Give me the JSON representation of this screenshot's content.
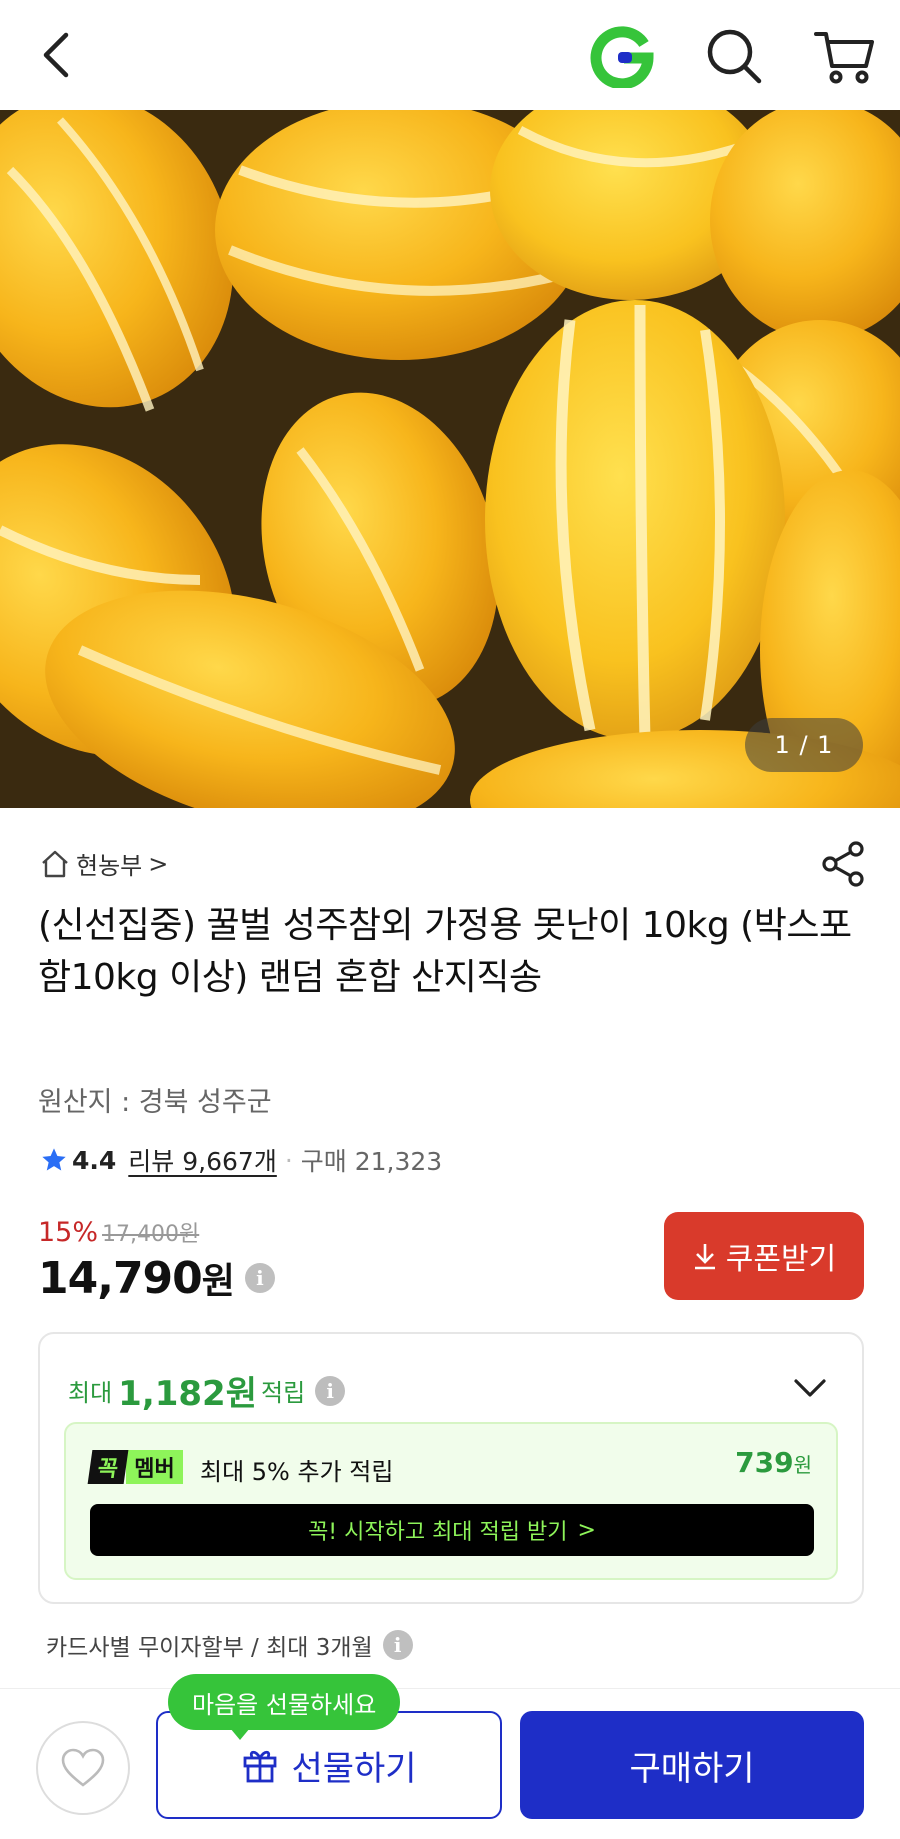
{
  "header": {
    "back_icon": "chevron-left-icon",
    "logo_letter": "G",
    "search_icon": "search-icon",
    "cart_icon": "cart-icon"
  },
  "gallery": {
    "image_description": "product photo",
    "pager": "1 / 1"
  },
  "store": {
    "name": "현농부",
    "arrow": ">"
  },
  "product": {
    "title": "(신선집중) 꿀벌 성주참외 가정용 못난이 10kg (박스포함10kg 이상) 랜덤 혼합 산지직송",
    "origin": "원산지 : 경북 성주군"
  },
  "rating": {
    "score": "4.4",
    "review_label": "리뷰 9,667개",
    "separator": "·",
    "purchase_label": "구매 21,323"
  },
  "price": {
    "discount_rate": "15%",
    "original": "17,400원",
    "current": "14,790",
    "unit": "원",
    "info": "i"
  },
  "coupon": {
    "label": "쿠폰받기"
  },
  "reward": {
    "prefix": "최대",
    "amount": "1,182원",
    "suffix": "적립",
    "info": "i",
    "member_badge_k": "꼭",
    "member_badge_m": "멤버",
    "member_text": "최대 5% 추가 적립",
    "member_amount": "739",
    "member_amount_unit": "원",
    "member_cta": "꼭! 시작하고 최대 적립 받기",
    "member_cta_arrow": ">"
  },
  "installment": {
    "text": "카드사별 무이자할부 / 최대 3개월",
    "info": "i"
  },
  "bottom": {
    "tooltip": "마음을 선물하세요",
    "gift_label": "선물하기",
    "buy_label": "구매하기"
  },
  "colors": {
    "accent_blue": "#1e2ec7",
    "coupon_red": "#d93a2b",
    "reward_green": "#2b9a3e",
    "member_lime": "#8ef45a",
    "tooltip_green": "#36c43a"
  }
}
